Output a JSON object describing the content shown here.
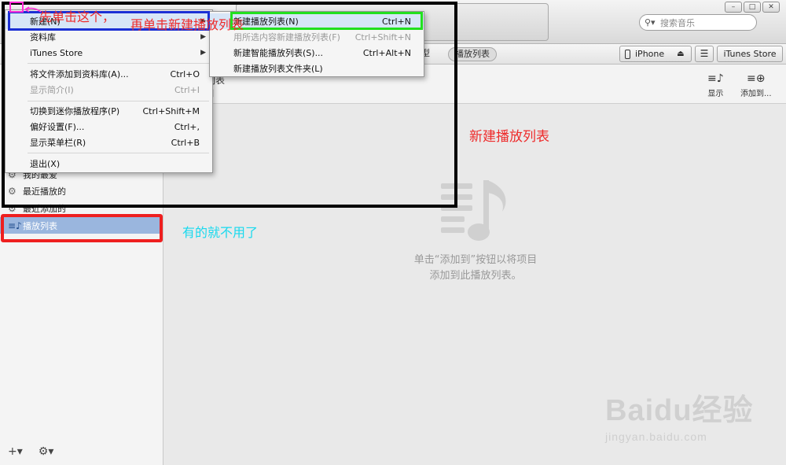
{
  "search": {
    "placeholder": "搜索音乐"
  },
  "filters": {
    "plain": "型",
    "selected": "播放列表"
  },
  "toolbar": {
    "iphone": "iPhone",
    "store": "iTunes Store"
  },
  "header": {
    "title": "列表",
    "sub": "目",
    "show": "显示",
    "add": "添加到..."
  },
  "sidebar": {
    "items": [
      {
        "label": "我的最爱",
        "icon": "gear-icon"
      },
      {
        "label": "最近播放的",
        "icon": "gear-icon"
      },
      {
        "label": "最近添加的",
        "icon": "gear-icon"
      },
      {
        "label": "播放列表",
        "icon": "playlist-icon"
      }
    ]
  },
  "empty": {
    "line1": "单击“添加到”按钮以将项目",
    "line2": "添加到此播放列表。"
  },
  "file_menu": [
    {
      "label": "新建(N)",
      "shortcut": "",
      "submenu": true,
      "highlighted": true
    },
    {
      "label": "资料库",
      "shortcut": "",
      "submenu": true
    },
    {
      "label": "iTunes Store",
      "shortcut": "",
      "submenu": true
    },
    {
      "label": "将文件添加到资料库(A)...",
      "shortcut": "Ctrl+O"
    },
    {
      "label": "显示简介(I)",
      "shortcut": "Ctrl+I",
      "disabled": true
    },
    {
      "label": "切换到迷你播放程序(P)",
      "shortcut": "Ctrl+Shift+M"
    },
    {
      "label": "偏好设置(F)...",
      "shortcut": "Ctrl+,"
    },
    {
      "label": "显示菜单栏(R)",
      "shortcut": "Ctrl+B"
    },
    {
      "label": "退出(X)",
      "shortcut": ""
    }
  ],
  "new_submenu": [
    {
      "label": "新建播放列表(N)",
      "shortcut": "Ctrl+N",
      "highlighted": true
    },
    {
      "label": "用所选内容新建播放列表(F)",
      "shortcut": "Ctrl+Shift+N",
      "disabled": true
    },
    {
      "label": "新建智能播放列表(S)...",
      "shortcut": "Ctrl+Alt+N"
    },
    {
      "label": "新建播放列表文件夹(L)",
      "shortcut": ""
    }
  ],
  "annotations": {
    "step1": "先单击这个，",
    "step2": "再单击新建播放列表",
    "result": "新建播放列表",
    "note": "有的就不用了"
  },
  "watermark": {
    "logo": "Baidu经验",
    "url": "jingyan.baidu.com"
  },
  "colors": {
    "sidebar_active": "#9ab6de",
    "annotation_red": "#ee2a2a",
    "annotation_cyan": "#18d9ee",
    "box_blue": "#1b2fd4",
    "box_green": "#22e01e"
  }
}
